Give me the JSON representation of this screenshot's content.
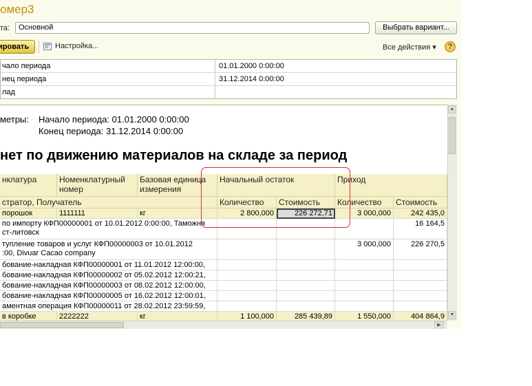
{
  "window": {
    "title": "омер3",
    "variant_label": "та:",
    "variant_value": "Основной",
    "choose_variant_button": "Выбрать вариант...",
    "generate_button": "ировать",
    "settings_button": "Настройка...",
    "all_actions": "Все действия ▾",
    "help": "?"
  },
  "params": [
    {
      "label": "чало периода",
      "value": "01.01.2000 0:00:00"
    },
    {
      "label": "нец периода",
      "value": "31.12.2014 0:00:00"
    },
    {
      "label": "лад",
      "value": ""
    }
  ],
  "report": {
    "params_label": "метры:",
    "start_period": "Начало периода: 01.01.2000 0:00:00",
    "end_period": "Конец периода: 31.12.2014 0:00:00",
    "title": "нет по движению материалов на складе за период",
    "headers": {
      "nomenclature": "нклатура",
      "nom_number": "Номенклатурный номер",
      "base_unit": "Базовая единица измерения",
      "opening_balance": "Начальный остаток",
      "receipt": "Приход",
      "registrar": "стратор, Получатель",
      "qty1": "Количество",
      "cost1": "Стоимость",
      "qty2": "Количество",
      "cost2": "Стоимость"
    },
    "rows": [
      {
        "name": "порошок",
        "number": "1111111",
        "unit": "кг",
        "qty1": "2 800,000",
        "cost1": "226 272,71",
        "qty2": "3 000,000",
        "cost2": "242 435,0",
        "group": true
      },
      {
        "name": "по импорту КФП00000001 от 10.01.2012 0:00:00, Таможня",
        "name2": "ст-литовск",
        "number": "",
        "unit": "",
        "qty1": "",
        "cost1": "",
        "qty2": "",
        "cost2": "16 164,5"
      },
      {
        "name": "тупление товаров и услуг КФП00000003 от 10.01.2012",
        "name2": ":00, Divuar Cacao company",
        "number": "",
        "unit": "",
        "qty1": "",
        "cost1": "",
        "qty2": "3 000,000",
        "cost2": "226 270,5"
      },
      {
        "name": "бование-накладная КФП00000001 от 11.01.2012 12:00:00,",
        "number": "",
        "unit": "",
        "qty1": "",
        "cost1": "",
        "qty2": "",
        "cost2": ""
      },
      {
        "name": "бование-накладная КФП00000002 от 05.02.2012 12:00:21,",
        "number": "",
        "unit": "",
        "qty1": "",
        "cost1": "",
        "qty2": "",
        "cost2": ""
      },
      {
        "name": "бование-накладная КФП00000003 от 08.02.2012 12:00:00,",
        "number": "",
        "unit": "",
        "qty1": "",
        "cost1": "",
        "qty2": "",
        "cost2": ""
      },
      {
        "name": "бование-накладная КФП00000005 от 16.02.2012 12:00:01,",
        "number": "",
        "unit": "",
        "qty1": "",
        "cost1": "",
        "qty2": "",
        "cost2": ""
      },
      {
        "name": "аментная операция КФП00000011 от 28.02.2012 23:59:59,",
        "number": "",
        "unit": "",
        "qty1": "",
        "cost1": "",
        "qty2": "",
        "cost2": ""
      },
      {
        "name": "в коробке",
        "number": "2222222",
        "unit": "кг",
        "qty1": "1 100,000",
        "cost1": "285 439,89",
        "qty2": "1 550,000",
        "cost2": "404 864,9",
        "group": true
      }
    ]
  }
}
